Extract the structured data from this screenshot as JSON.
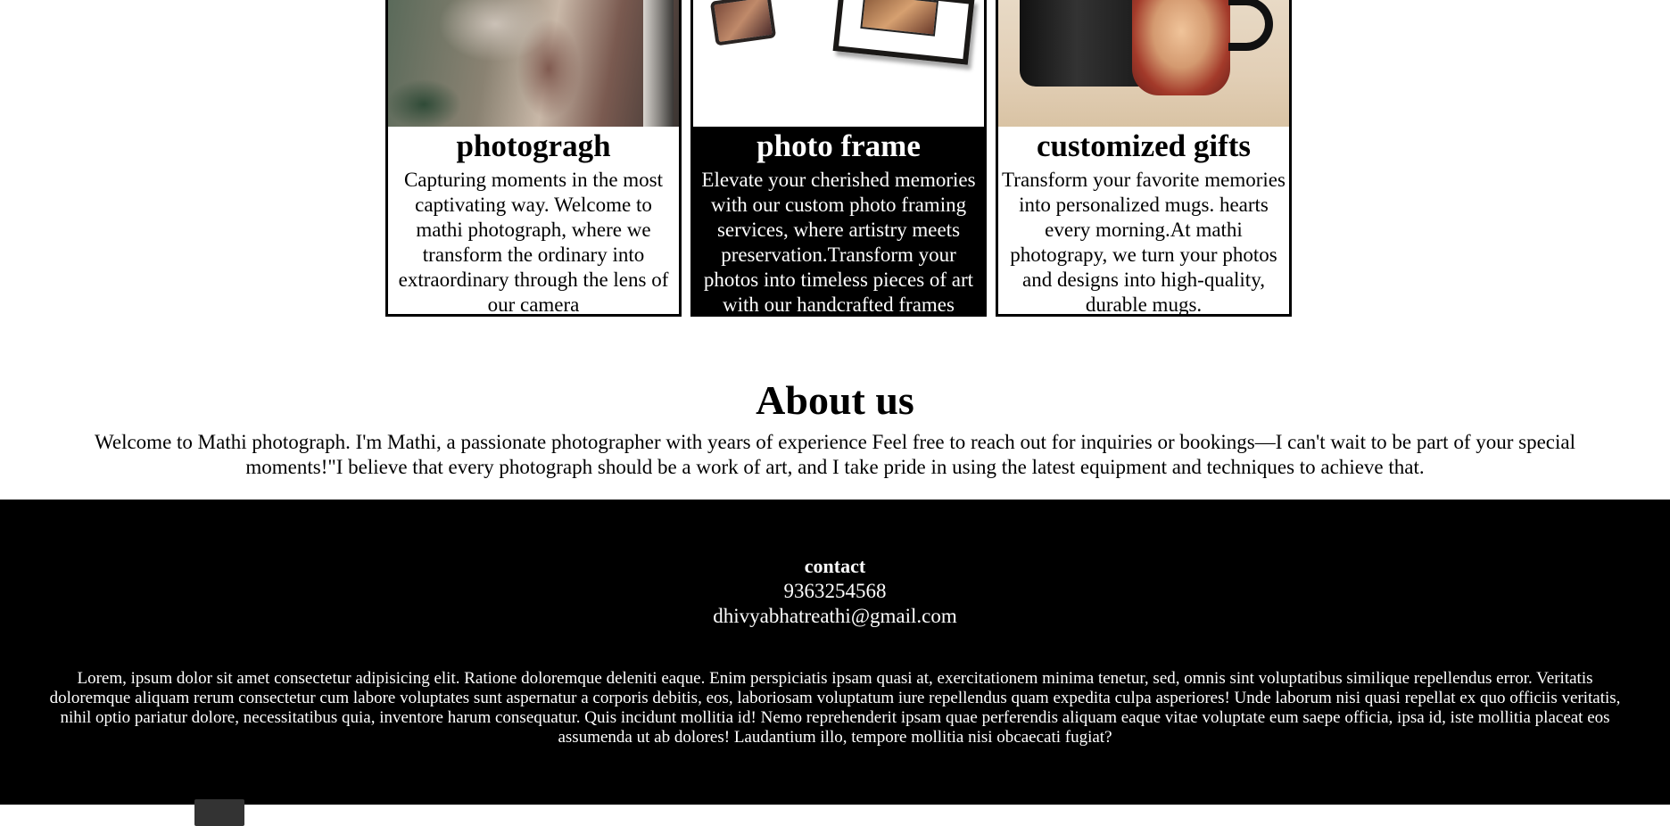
{
  "services": [
    {
      "title": "photogragh",
      "description": "Capturing moments in the most captivating way. Welcome to mathi photograph, where we transform the ordinary into extraordinary through the lens of our camera"
    },
    {
      "title": "photo frame",
      "description": "Elevate your cherished memories with our custom photo framing services, where artistry meets preservation.Transform your photos into timeless pieces of art with our handcrafted frames"
    },
    {
      "title": "customized gifts",
      "description": "Transform your favorite memories into personalized mugs. hearts every morning.At mathi photograpy, we turn your photos and designs into high-quality, durable mugs."
    }
  ],
  "about": {
    "heading": "About us",
    "text": "Welcome to Mathi photograph. I'm Mathi, a passionate photographer with years of experience Feel free to reach out for inquiries or bookings—I can't wait to be part of your special moments!\"I believe that every photograph should be a work of art, and I take pride in using the latest equipment and techniques to achieve that."
  },
  "footer": {
    "contact_heading": "contact",
    "phone": "9363254568",
    "email": "dhivyabhatreathi@gmail.com",
    "lorem": "Lorem, ipsum dolor sit amet consectetur adipisicing elit. Ratione doloremque deleniti eaque. Enim perspiciatis ipsam quasi at, exercitationem minima tenetur, sed, omnis sint voluptatibus similique repellendus error. Veritatis doloremque aliquam rerum consectetur cum labore voluptates sunt aspernatur a corporis debitis, eos, laboriosam voluptatum iure repellendus quam expedita culpa asperiores! Unde laborum nisi quasi repellat ex quo officiis veritatis, nihil optio pariatur dolore, necessitatibus quia, inventore harum consequatur. Quis incidunt mollitia id! Nemo reprehenderit ipsam quae perferendis aliquam eaque vitae voluptate eum saepe officia, ipsa id, iste mollitia placeat eos assumenda ut ab dolores! Laudantium illo, tempore mollitia nisi obcaecati fugiat?"
  },
  "colors": {
    "background": "#ffffff",
    "footer_background": "#000000",
    "highlight_card": "#000000",
    "text": "#000000"
  }
}
